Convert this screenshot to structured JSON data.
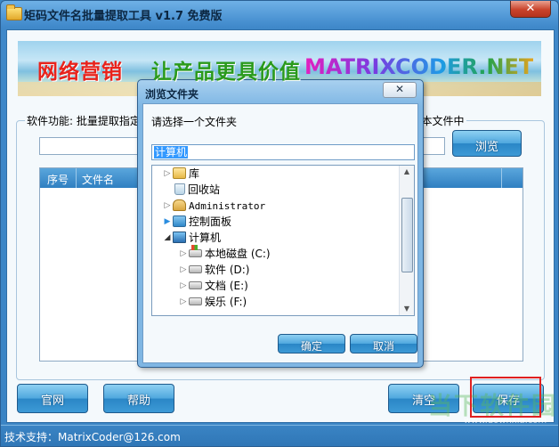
{
  "window": {
    "title": "矩码文件名批量提取工具 v1.7 免费版",
    "close_symbol": "✕"
  },
  "banner": {
    "cn_part1": "网络营销",
    "cn_part2": "让产品更具价值",
    "en": "MATRIXCODER.NET"
  },
  "main": {
    "function_label": "软件功能: 批量提取指定",
    "function_label_tail": "文本文件中",
    "path_value": "",
    "browse_label": "浏览",
    "list_headers": [
      "序号",
      "文件名"
    ]
  },
  "buttons": {
    "website": "官网",
    "help": "帮助",
    "clear": "清空",
    "save": "保存"
  },
  "footer": {
    "support": "技术支持：MatrixCoder@126.com"
  },
  "watermark": {
    "text": "当下软件园",
    "url": "www.downxia.com"
  },
  "dialog": {
    "title": "浏览文件夹",
    "close_symbol": "✕",
    "prompt": "请选择一个文件夹",
    "selected_value": "计算机",
    "tree": [
      {
        "label": "库",
        "arrow": "▷",
        "icon": "library-icon"
      },
      {
        "label": "回收站",
        "arrow": "",
        "icon": "recycle-bin-icon"
      },
      {
        "label": "Administrator",
        "arrow": "▷",
        "icon": "user-folder-icon"
      },
      {
        "label": "控制面板",
        "arrow": "▶",
        "icon": "control-panel-icon"
      },
      {
        "label": "计算机",
        "arrow": "◢",
        "icon": "computer-icon"
      },
      {
        "label": "本地磁盘 (C:)",
        "arrow": "▷",
        "icon": "system-drive-icon"
      },
      {
        "label": "软件 (D:)",
        "arrow": "▷",
        "icon": "drive-icon"
      },
      {
        "label": "文档 (E:)",
        "arrow": "▷",
        "icon": "drive-icon"
      },
      {
        "label": "娱乐 (F:)",
        "arrow": "▷",
        "icon": "drive-icon"
      }
    ],
    "ok": "确定",
    "cancel": "取消"
  },
  "colors": {
    "window_frame": "#3a84c4",
    "button_blue": "#4fa7de",
    "highlight_red": "#e02020"
  }
}
